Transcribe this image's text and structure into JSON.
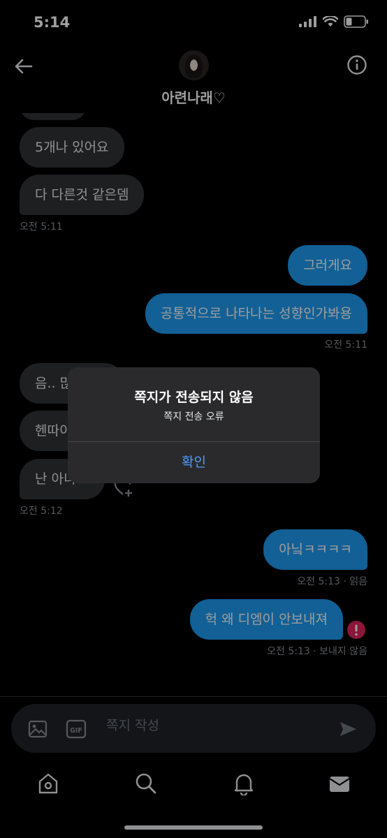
{
  "status_bar": {
    "time": "5:14"
  },
  "header": {
    "name": "아련나래♡"
  },
  "messages": {
    "m1": "5개나 있어요",
    "m2": "다 다른것 같은뎀",
    "t1": "오전 5:11",
    "m3": "그러게요",
    "m4": "공통적으로 나타나는 성향인가봐용",
    "t2": "오전 5:11",
    "m5": "음.. 많",
    "m6": "헨따이",
    "m7": "난 아니",
    "t3": "오전 5:12",
    "m8": "아닠ㅋㅋㅋㅋ",
    "t4": "오전 5:13 · 읽음",
    "m9": "헉 왜 디엠이 안보내져",
    "t5": "오전 5:13 · 보내지 않음"
  },
  "alert": {
    "title": "쪽지가 전송되지 않음",
    "message": "쪽지 전송 오류",
    "button": "확인"
  },
  "composer": {
    "placeholder": "쪽지 작성",
    "gif_label": "GIF"
  },
  "colors": {
    "accent": "#1d9bf0",
    "error": "#e0245e",
    "alert_button": "#4a9ef6"
  }
}
